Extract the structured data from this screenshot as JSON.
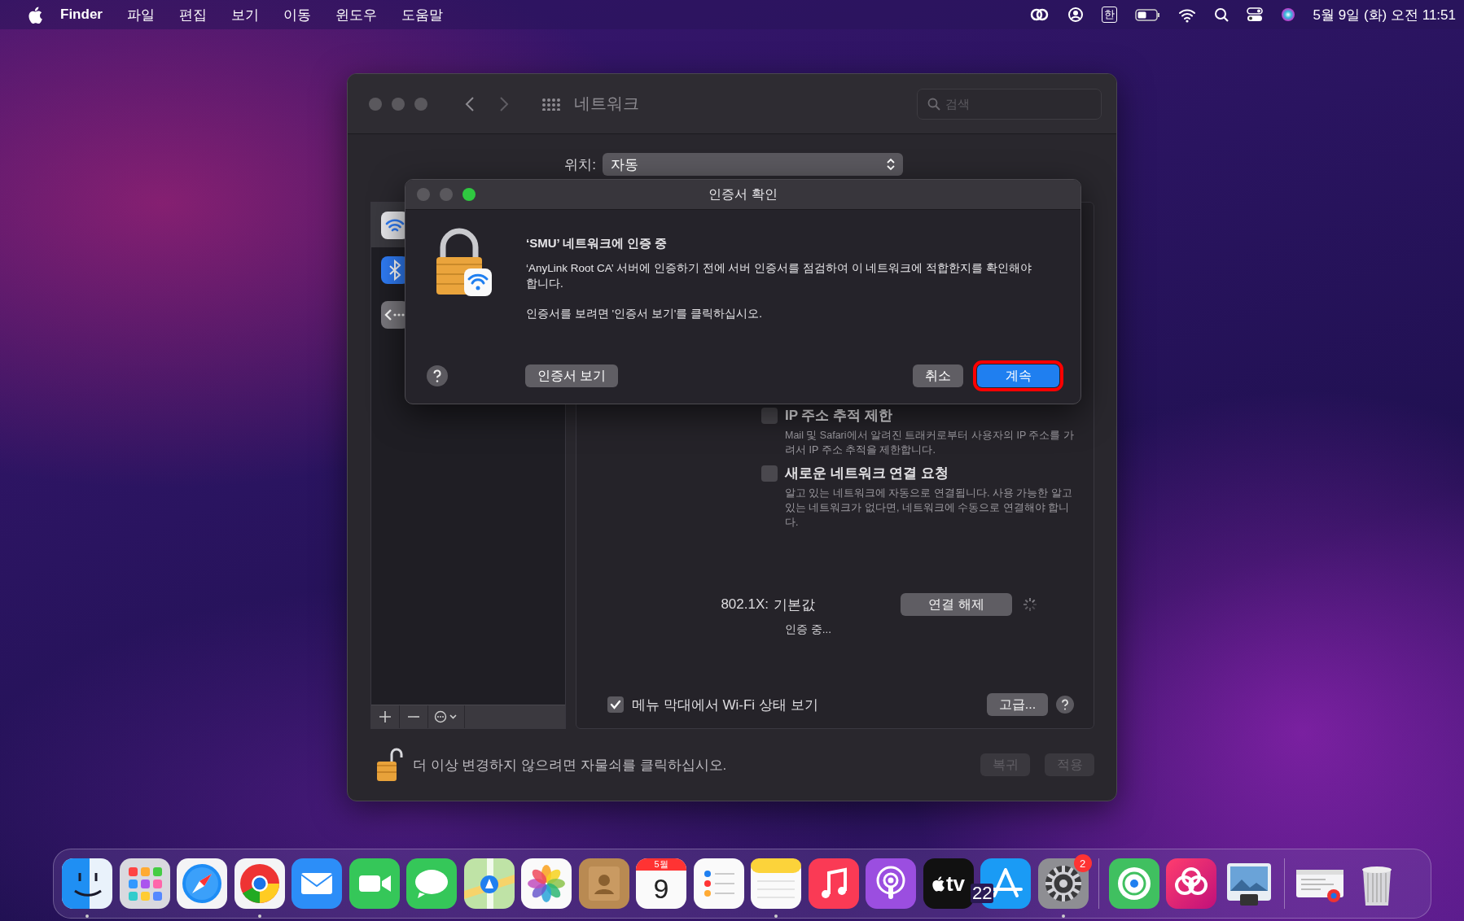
{
  "menu_bar": {
    "menus": [
      {
        "label": "Finder",
        "kind": "app"
      },
      {
        "label": "파일",
        "kind": "menu"
      },
      {
        "label": "편집",
        "kind": "menu"
      },
      {
        "label": "보기",
        "kind": "menu"
      },
      {
        "label": "이동",
        "kind": "menu"
      },
      {
        "label": "윈도우",
        "kind": "menu"
      },
      {
        "label": "도움말",
        "kind": "menu"
      }
    ],
    "input_method": "한",
    "clock": "5월 9일 (화) 오전 11:51"
  },
  "window": {
    "title": "네트워크",
    "search": {
      "placeholder": "검색"
    },
    "location": {
      "label": "위치:",
      "value": "자동"
    },
    "sidebar": {
      "items": [
        {
          "kind": "wifi",
          "selected": true
        },
        {
          "kind": "bluetooth",
          "selected": false
        },
        {
          "kind": "ethernet",
          "selected": false
        }
      ]
    },
    "options": [
      {
        "label": "IP 주소 추적 제한",
        "checked": false,
        "description": "Mail 및 Safari에서 알려진 트래커로부터 사용자의 IP 주소를 가려서 IP 주소 추적을 제한합니다."
      },
      {
        "label": "새로운 네트워크 연결 요청",
        "checked": false,
        "description": "알고 있는 네트워크에 자동으로 연결됩니다. 사용 가능한 알고 있는 네트워크가 없다면, 네트워크에 수동으로 연결해야 합니다."
      }
    ],
    "dot1x": {
      "label": "802.1X:",
      "value": "기본값",
      "status": "인증 중...",
      "button": "연결 해제"
    },
    "show_wifi_status": {
      "label": "메뉴 막대에서 Wi-Fi 상태 보기",
      "checked": true
    },
    "advanced_button": "고급...",
    "lock_message": "더 이상 변경하지 않으려면 자물쇠를 클릭하십시오.",
    "buttons": [
      {
        "label": "복귀",
        "disabled": true
      },
      {
        "label": "적용",
        "disabled": true
      }
    ]
  },
  "dialog": {
    "title": "인증서 확인",
    "heading": "‘SMU’ 네트워크에 인증 중",
    "message": "‘AnyLink Root CA’ 서버에 인증하기 전에 서버 인증서를 점검하여 이 네트워크에 적합한지를 확인해야 합니다.",
    "hint": "인증서를 보려면 '인증서 보기'를 클릭하십시오.",
    "buttons": [
      {
        "label": "인증서 보기",
        "kind": "secondary",
        "highlighted": false
      },
      {
        "label": "취소",
        "kind": "secondary",
        "highlighted": false
      },
      {
        "label": "계속",
        "kind": "default",
        "highlighted": true
      }
    ]
  },
  "dock": {
    "groups": [
      {
        "items": [
          {
            "kind": "finder",
            "running": true
          },
          {
            "kind": "launchpad",
            "running": false
          },
          {
            "kind": "safari",
            "running": false
          },
          {
            "kind": "chrome",
            "running": true
          },
          {
            "kind": "mail",
            "running": false
          },
          {
            "kind": "facetime",
            "running": false
          },
          {
            "kind": "messages",
            "running": false
          },
          {
            "kind": "maps",
            "running": false
          },
          {
            "kind": "photos",
            "running": false
          },
          {
            "kind": "contacts",
            "running": false
          },
          {
            "kind": "calendar",
            "running": false,
            "month": "5월",
            "day": "9"
          },
          {
            "kind": "reminders",
            "running": false
          },
          {
            "kind": "notes",
            "running": true
          },
          {
            "kind": "music",
            "running": false
          },
          {
            "kind": "podcasts",
            "running": false
          },
          {
            "kind": "tv",
            "running": false,
            "label": "tv"
          },
          {
            "kind": "appstore",
            "running": false
          },
          {
            "kind": "settings",
            "running": true,
            "badge": "2"
          }
        ]
      },
      {
        "items": [
          {
            "kind": "findmy",
            "running": false
          },
          {
            "kind": "cloud",
            "running": false
          },
          {
            "kind": "preview",
            "running": false
          }
        ]
      },
      {
        "items": [
          {
            "kind": "document",
            "running": false
          },
          {
            "kind": "trash",
            "running": false
          }
        ]
      }
    ]
  },
  "page_number": "22"
}
